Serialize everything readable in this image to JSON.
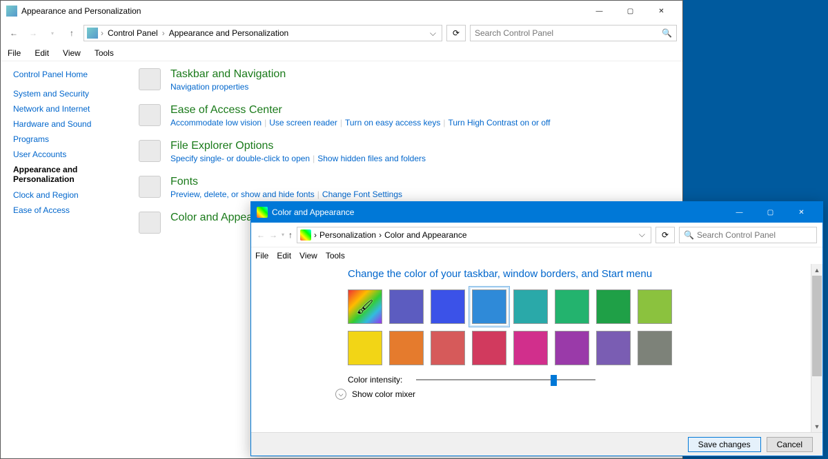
{
  "parent_window": {
    "title": "Appearance and Personalization",
    "breadcrumb": [
      "Control Panel",
      "Appearance and Personalization"
    ],
    "search_placeholder": "Search Control Panel",
    "menu": [
      "File",
      "Edit",
      "View",
      "Tools"
    ],
    "sidebar": [
      {
        "label": "Control Panel Home"
      },
      {
        "label": "System and Security"
      },
      {
        "label": "Network and Internet"
      },
      {
        "label": "Hardware and Sound"
      },
      {
        "label": "Programs"
      },
      {
        "label": "User Accounts"
      },
      {
        "label": "Appearance and Personalization",
        "active": true
      },
      {
        "label": "Clock and Region"
      },
      {
        "label": "Ease of Access"
      }
    ],
    "categories": [
      {
        "title": "Taskbar and Navigation",
        "links": [
          "Navigation properties"
        ]
      },
      {
        "title": "Ease of Access Center",
        "links": [
          "Accommodate low vision",
          "Use screen reader",
          "Turn on easy access keys",
          "Turn High Contrast on or off"
        ]
      },
      {
        "title": "File Explorer Options",
        "links": [
          "Specify single- or double-click to open",
          "Show hidden files and folders"
        ]
      },
      {
        "title": "Fonts",
        "links": [
          "Preview, delete, or show and hide fonts",
          "Change Font Settings"
        ]
      },
      {
        "title": "Color and Appearance",
        "links": []
      }
    ]
  },
  "child_window": {
    "title": "Color and Appearance",
    "breadcrumb": [
      "Personalization",
      "Color and Appearance"
    ],
    "search_placeholder": "Search Control Panel",
    "menu": [
      "File",
      "Edit",
      "View",
      "Tools"
    ],
    "heading": "Change the color of your taskbar, window borders, and Start menu",
    "swatches": [
      {
        "color": "auto",
        "label": "Automatic"
      },
      {
        "color": "#5c5cc0"
      },
      {
        "color": "#3b52e8"
      },
      {
        "color": "#2f8ad8",
        "selected": true
      },
      {
        "color": "#2aa9a9"
      },
      {
        "color": "#23b36e"
      },
      {
        "color": "#1fa047"
      },
      {
        "color": "#8bc23e"
      },
      {
        "color": "#f2d516"
      },
      {
        "color": "#e57b2d"
      },
      {
        "color": "#d65a5a"
      },
      {
        "color": "#d13a5e"
      },
      {
        "color": "#d12f8c"
      },
      {
        "color": "#9a3aa9"
      },
      {
        "color": "#7a5db3"
      },
      {
        "color": "#7d8279"
      }
    ],
    "intensity_label": "Color intensity:",
    "intensity_value": 0.75,
    "mixer_label": "Show color mixer",
    "buttons": {
      "save": "Save changes",
      "cancel": "Cancel"
    }
  }
}
